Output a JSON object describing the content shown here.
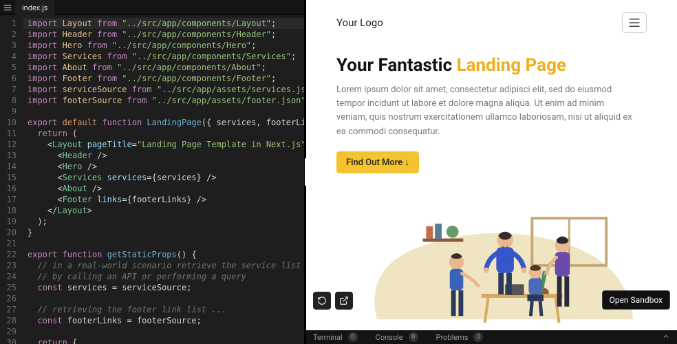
{
  "editor": {
    "filename": "index.js",
    "lines": [
      {
        "n": 1,
        "hl": true,
        "tokens": [
          [
            "kw",
            "import"
          ],
          [
            "",
            ""
          ],
          [
            "id",
            " Layout "
          ],
          [
            "kw",
            "from"
          ],
          [
            "",
            " "
          ],
          [
            "str",
            "\"../src/app/components/Layout\""
          ],
          [
            "punct",
            ";"
          ]
        ]
      },
      {
        "n": 2,
        "tokens": [
          [
            "kw",
            "import"
          ],
          [
            "id",
            " Header "
          ],
          [
            "kw",
            "from"
          ],
          [
            "",
            " "
          ],
          [
            "str",
            "\"../src/app/components/Header\""
          ],
          [
            "punct",
            ";"
          ]
        ]
      },
      {
        "n": 3,
        "tokens": [
          [
            "kw",
            "import"
          ],
          [
            "id",
            " Hero "
          ],
          [
            "kw",
            "from"
          ],
          [
            "",
            " "
          ],
          [
            "str",
            "\"../src/app/components/Hero\""
          ],
          [
            "punct",
            ";"
          ]
        ]
      },
      {
        "n": 4,
        "tokens": [
          [
            "kw",
            "import"
          ],
          [
            "id",
            " Services "
          ],
          [
            "kw",
            "from"
          ],
          [
            "",
            " "
          ],
          [
            "str",
            "\"../src/app/components/Services\""
          ],
          [
            "punct",
            ";"
          ]
        ]
      },
      {
        "n": 5,
        "tokens": [
          [
            "kw",
            "import"
          ],
          [
            "id",
            " About "
          ],
          [
            "kw",
            "from"
          ],
          [
            "",
            " "
          ],
          [
            "str",
            "\"../src/app/components/About\""
          ],
          [
            "punct",
            ";"
          ]
        ]
      },
      {
        "n": 6,
        "tokens": [
          [
            "kw",
            "import"
          ],
          [
            "id",
            " Footer "
          ],
          [
            "kw",
            "from"
          ],
          [
            "",
            " "
          ],
          [
            "str",
            "\"../src/app/components/Footer\""
          ],
          [
            "punct",
            ";"
          ]
        ]
      },
      {
        "n": 7,
        "tokens": [
          [
            "kw",
            "import"
          ],
          [
            "id",
            " serviceSource "
          ],
          [
            "kw",
            "from"
          ],
          [
            "",
            " "
          ],
          [
            "str",
            "\"../src/app/assets/services.json\""
          ],
          [
            "punct",
            ";"
          ]
        ]
      },
      {
        "n": 8,
        "tokens": [
          [
            "kw",
            "import"
          ],
          [
            "id",
            " footerSource "
          ],
          [
            "kw",
            "from"
          ],
          [
            "",
            " "
          ],
          [
            "str",
            "\"../src/app/assets/footer.json\""
          ],
          [
            "punct",
            ";"
          ]
        ]
      },
      {
        "n": 9,
        "tokens": [
          [
            "",
            ""
          ]
        ]
      },
      {
        "n": 10,
        "tokens": [
          [
            "kw",
            "export "
          ],
          [
            "pink",
            "default "
          ],
          [
            "kw",
            "function "
          ],
          [
            "fn",
            "LandingPage"
          ],
          [
            "punct",
            "({ "
          ],
          [
            "",
            "services, footerLinks"
          ]
        ]
      },
      {
        "n": 11,
        "tokens": [
          [
            "",
            "  "
          ],
          [
            "kw",
            "return"
          ],
          [
            "punct",
            " ("
          ]
        ]
      },
      {
        "n": 12,
        "tokens": [
          [
            "",
            "    <"
          ],
          [
            "comp",
            "Layout"
          ],
          [
            "",
            " "
          ],
          [
            "attr",
            "pageTitle"
          ],
          [
            "punct",
            "="
          ],
          [
            "str",
            "\"Landing Page Template in Next.js\""
          ],
          [
            "punct",
            ">"
          ]
        ]
      },
      {
        "n": 13,
        "tokens": [
          [
            "",
            "      <"
          ],
          [
            "comp",
            "Header"
          ],
          [
            "punct",
            " />"
          ]
        ]
      },
      {
        "n": 14,
        "tokens": [
          [
            "",
            "      <"
          ],
          [
            "comp",
            "Hero"
          ],
          [
            "punct",
            " />"
          ]
        ]
      },
      {
        "n": 15,
        "tokens": [
          [
            "",
            "      <"
          ],
          [
            "comp",
            "Services"
          ],
          [
            "",
            " "
          ],
          [
            "attr",
            "services"
          ],
          [
            "punct",
            "={"
          ],
          [
            "",
            "services"
          ],
          [
            "punct",
            "} />"
          ]
        ]
      },
      {
        "n": 16,
        "tokens": [
          [
            "",
            "      <"
          ],
          [
            "comp",
            "About"
          ],
          [
            "punct",
            " />"
          ]
        ]
      },
      {
        "n": 17,
        "tokens": [
          [
            "",
            "      <"
          ],
          [
            "comp",
            "Footer"
          ],
          [
            "",
            " "
          ],
          [
            "attr",
            "links"
          ],
          [
            "punct",
            "={"
          ],
          [
            "",
            "footerLinks"
          ],
          [
            "punct",
            "} />"
          ]
        ]
      },
      {
        "n": 18,
        "tokens": [
          [
            "",
            "    </"
          ],
          [
            "comp",
            "Layout"
          ],
          [
            "punct",
            ">"
          ]
        ]
      },
      {
        "n": 19,
        "tokens": [
          [
            "",
            "  "
          ],
          [
            "punct",
            ");"
          ]
        ]
      },
      {
        "n": 20,
        "tokens": [
          [
            "punct",
            "}"
          ]
        ]
      },
      {
        "n": 21,
        "tokens": [
          [
            "",
            ""
          ]
        ]
      },
      {
        "n": 22,
        "tokens": [
          [
            "kw",
            "export "
          ],
          [
            "kw",
            "function "
          ],
          [
            "fn",
            "getStaticProps"
          ],
          [
            "punct",
            "() {"
          ]
        ]
      },
      {
        "n": 23,
        "tokens": [
          [
            "",
            "  "
          ],
          [
            "comment",
            "// in a real-world scenario retrieve the service list"
          ]
        ]
      },
      {
        "n": 24,
        "tokens": [
          [
            "",
            "  "
          ],
          [
            "comment",
            "// by calling an API or performing a query"
          ]
        ]
      },
      {
        "n": 25,
        "tokens": [
          [
            "",
            "  "
          ],
          [
            "kw",
            "const"
          ],
          [
            "",
            " services = serviceSource"
          ],
          [
            "punct",
            ";"
          ]
        ]
      },
      {
        "n": 26,
        "tokens": [
          [
            "",
            ""
          ]
        ]
      },
      {
        "n": 27,
        "tokens": [
          [
            "",
            "  "
          ],
          [
            "comment",
            "// retrieving the footer link list ..."
          ]
        ]
      },
      {
        "n": 28,
        "tokens": [
          [
            "",
            "  "
          ],
          [
            "kw",
            "const"
          ],
          [
            "",
            " footerLinks = footerSource"
          ],
          [
            "punct",
            ";"
          ]
        ]
      },
      {
        "n": 29,
        "tokens": [
          [
            "",
            ""
          ]
        ]
      },
      {
        "n": 30,
        "tokens": [
          [
            "",
            "  "
          ],
          [
            "kw",
            "return"
          ],
          [
            "punct",
            " {"
          ]
        ]
      }
    ]
  },
  "preview": {
    "brand": "Your Logo",
    "heading_a": "Your Fantastic ",
    "heading_b": "Landing Page",
    "body": "Lorem ipsum dolor sit amet, consectetur adipisci elit, sed do eiusmod tempor incidunt ut labore et dolore magna aliqua. Ut enim ad minim veniam, quis nostrum exercitationem ullamco laboriosam, nisi ut aliquid ex ea commodi consequatur.",
    "cta": "Find Out More ↓",
    "open_sandbox": "Open Sandbox"
  },
  "bottom": {
    "tabs": [
      {
        "label": "Terminal",
        "count": "0"
      },
      {
        "label": "Console",
        "count": "0"
      },
      {
        "label": "Problems",
        "count": "0"
      }
    ]
  }
}
